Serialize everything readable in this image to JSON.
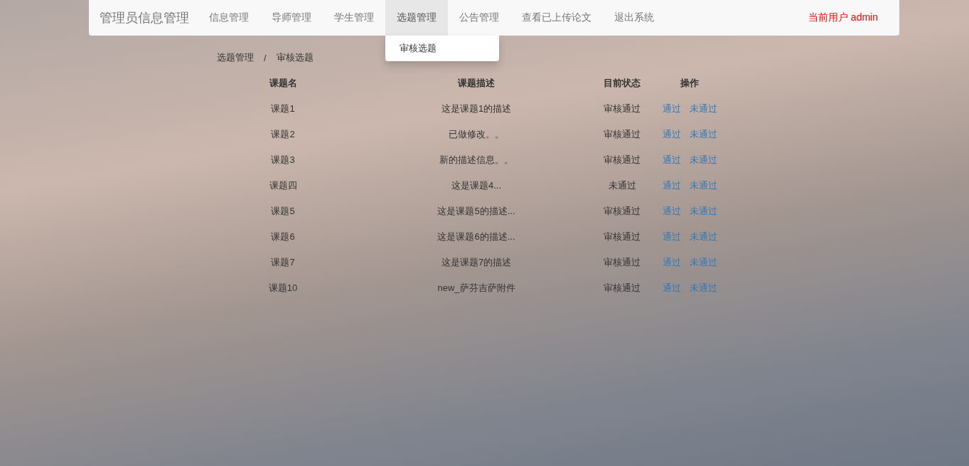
{
  "navbar": {
    "brand": "管理员信息管理",
    "items": [
      {
        "label": "信息管理",
        "selected": false
      },
      {
        "label": "导师管理",
        "selected": false
      },
      {
        "label": "学生管理",
        "selected": false
      },
      {
        "label": "选题管理",
        "selected": true,
        "children": [
          {
            "label": "审核选题"
          }
        ]
      },
      {
        "label": "公告管理",
        "selected": false
      },
      {
        "label": "查看已上传论文",
        "selected": false
      },
      {
        "label": "退出系统",
        "selected": false
      }
    ],
    "current_user": "当前用户 admin"
  },
  "breadcrumb": [
    "选题管理",
    "审核选题"
  ],
  "breadcrumb_separator": "/",
  "table": {
    "columns": [
      "课题名",
      "课题描述",
      "目前状态",
      "操作"
    ],
    "rows": [
      {
        "name": "课题1",
        "description": "这是课题1的描述",
        "status": "审核通过",
        "actions": [
          "通过",
          "未通过"
        ]
      },
      {
        "name": "课题2",
        "description": "已做修改。。",
        "status": "审核通过",
        "actions": [
          "通过",
          "未通过"
        ]
      },
      {
        "name": "课题3",
        "description": "新的描述信息。。",
        "status": "审核通过",
        "actions": [
          "通过",
          "未通过"
        ]
      },
      {
        "name": "课题四",
        "description": "这是课题4...",
        "status": "未通过",
        "actions": [
          "通过",
          "未通过"
        ]
      },
      {
        "name": "课题5",
        "description": "这是课题5的描述...",
        "status": "审核通过",
        "actions": [
          "通过",
          "未通过"
        ]
      },
      {
        "name": "课题6",
        "description": "这是课题6的描述...",
        "status": "审核通过",
        "actions": [
          "通过",
          "未通过"
        ]
      },
      {
        "name": "课题7",
        "description": "这是课题7的描述",
        "status": "审核通过",
        "actions": [
          "通过",
          "未通过"
        ]
      },
      {
        "name": "课题10",
        "description": "new_萨芬吉萨附件",
        "status": "审核通过",
        "actions": [
          "通过",
          "未通过"
        ]
      }
    ]
  }
}
